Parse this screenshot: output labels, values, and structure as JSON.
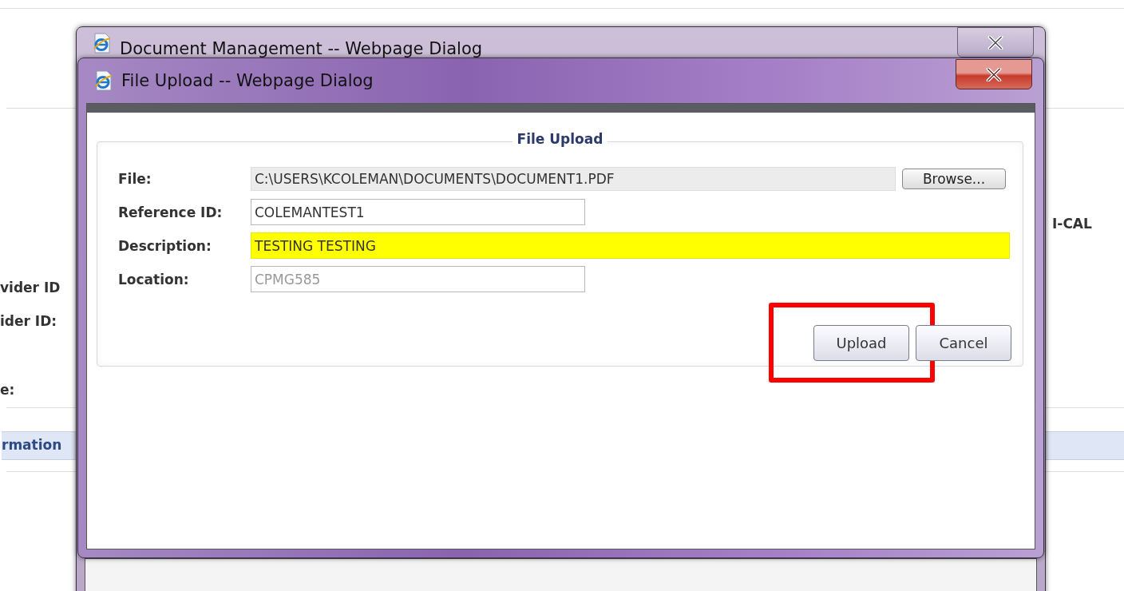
{
  "background_page": {
    "texts": [
      {
        "text": "vider ID",
        "kind": "label"
      },
      {
        "text": "ider ID:",
        "kind": "label"
      },
      {
        "text": "e:",
        "kind": "label"
      },
      {
        "text": "rmation",
        "kind": "tab"
      },
      {
        "text": "I-CAL",
        "kind": "side"
      }
    ]
  },
  "windows": [
    {
      "title": "Document Management -- Webpage Dialog",
      "active": false
    },
    {
      "title": "File Upload -- Webpage Dialog",
      "active": true
    }
  ],
  "form": {
    "legend": "File Upload",
    "fields": [
      {
        "label": "File:",
        "value": "C:\\USERS\\KCOLEMAN\\DOCUMENTS\\DOCUMENT1.PDF",
        "kind": "file",
        "disabled": false,
        "highlighted": false
      },
      {
        "label": "Reference ID:",
        "value": "COLEMANTEST1",
        "kind": "short",
        "disabled": false,
        "highlighted": false
      },
      {
        "label": "Description:",
        "value": "TESTING TESTING",
        "kind": "wide",
        "disabled": false,
        "highlighted": true
      },
      {
        "label": "Location:",
        "value": "CPMG585",
        "kind": "short",
        "disabled": true,
        "highlighted": false
      }
    ],
    "browse_button": "Browse...",
    "buttons": [
      {
        "label": "Upload",
        "highlighted": true
      },
      {
        "label": "Cancel",
        "highlighted": false
      }
    ]
  }
}
